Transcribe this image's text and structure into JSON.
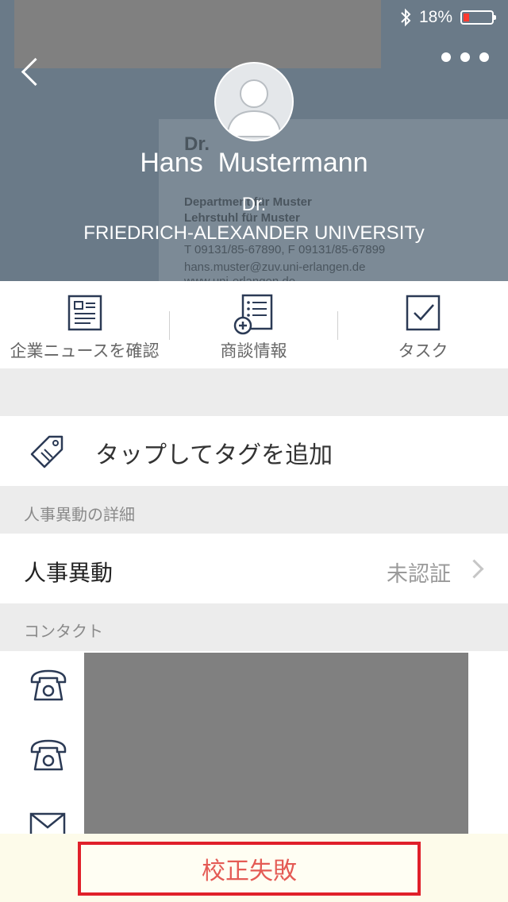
{
  "status_bar": {
    "battery": "18%",
    "battery_level": 0.18
  },
  "profile": {
    "name": "Hans  Mustermann",
    "title": "Dr.",
    "organization": "FRIEDRICH-ALEXANDER UNIVERSITy"
  },
  "card_image_text": {
    "line1": "Dr.",
    "line2": "Department für Muster",
    "line3": "Lehrstuhl für Muster",
    "line4": "T 09131/85-67890, F 09131/85-67899",
    "line5": "hans.muster@zuv.uni-erlangen.de",
    "line6": "www.uni-erlangen.de"
  },
  "actions": [
    {
      "label": "企業ニュースを確認",
      "icon": "news-icon"
    },
    {
      "label": "商談情報",
      "icon": "deal-list-icon"
    },
    {
      "label": "タスク",
      "icon": "task-check-icon"
    }
  ],
  "tag": {
    "label": "タップしてタグを追加",
    "icon": "tag-icon"
  },
  "sections": {
    "personnel": "人事異動の詳細",
    "contact": "コンタクト"
  },
  "personnel_row": {
    "label": "人事異動",
    "value": "未認証"
  },
  "contact_icons": [
    "phone-icon",
    "phone-icon",
    "mail-icon"
  ],
  "footer": {
    "button": "校正失敗"
  },
  "colors": {
    "accent_red": "#e0202a",
    "header_bg": "#6a7a88"
  }
}
